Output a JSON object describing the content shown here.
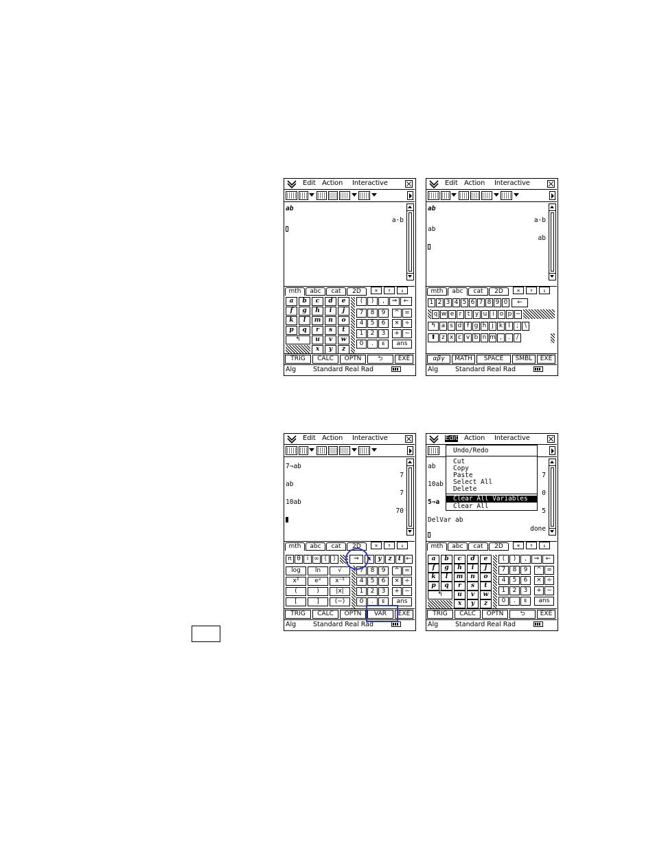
{
  "menu": {
    "edit": "Edit",
    "action": "Action",
    "interactive": "Interactive"
  },
  "tabs": {
    "mth": "mth",
    "abc": "abc",
    "cat": "cat",
    "d2": "2D"
  },
  "softkeys_mth": [
    "TRIG",
    "CALC",
    "OPTN",
    "⮌",
    "EXE"
  ],
  "softkeys_var": [
    "TRIG",
    "CALC",
    "OPTN",
    "VAR",
    "EXE"
  ],
  "softkeys_abc": [
    "αβγ",
    "MATH",
    "SPACE",
    "SMBL",
    "EXE"
  ],
  "status": {
    "mode": "Alg",
    "settings": "Standard Real Rad"
  },
  "screen1": {
    "lines": [
      {
        "text": "ab",
        "style": "b",
        "align": "l"
      },
      {
        "text": "a·b",
        "align": "r"
      }
    ]
  },
  "screen2": {
    "lines": [
      {
        "text": "ab",
        "style": "b",
        "align": "l"
      },
      {
        "text": "a·b",
        "align": "r"
      },
      {
        "text": "ab",
        "align": "l"
      },
      {
        "text": "ab",
        "align": "r"
      }
    ]
  },
  "screen3": {
    "lines": [
      {
        "text": "7⇒ab",
        "align": "l"
      },
      {
        "text": "7",
        "align": "r"
      },
      {
        "text": "ab",
        "align": "l"
      },
      {
        "text": "7",
        "align": "r"
      },
      {
        "text": "10ab",
        "align": "l"
      },
      {
        "text": "70",
        "align": "r"
      }
    ]
  },
  "screen4": {
    "lines": [
      {
        "text": "ab",
        "align": "l"
      },
      {
        "text": "7",
        "align": "r"
      },
      {
        "text": "10ab",
        "align": "l"
      },
      {
        "text": "0",
        "align": "r"
      },
      {
        "text": "5⇒a",
        "align": "l"
      },
      {
        "text": "5",
        "align": "r"
      },
      {
        "text": "DelVar ab",
        "align": "l"
      },
      {
        "text": "done",
        "align": "r"
      }
    ],
    "dropdown": [
      "Undo/Redo",
      "Cut",
      "Copy",
      "Paste",
      "Select All",
      "Delete",
      "Clear All Variables",
      "Clear All"
    ]
  },
  "keypad_letters": [
    "a",
    "b",
    "c",
    "d",
    "e",
    "f",
    "g",
    "h",
    "i",
    "j",
    "k",
    "l",
    "m",
    "n",
    "o",
    "p",
    "q",
    "r",
    "s",
    "t",
    "u",
    "v",
    "w",
    "x",
    "y",
    "z"
  ],
  "keypad_numeric": [
    "(",
    ")",
    ",",
    "⇒",
    "←",
    "7",
    "8",
    "9",
    "^",
    "=",
    "4",
    "5",
    "6",
    "×",
    "÷",
    "1",
    "2",
    "3",
    "+",
    "−",
    "0",
    ".",
    "E",
    "ans"
  ],
  "keypad_symbols": [
    "π",
    "θ",
    "i",
    "∞",
    "⟨",
    "⟩",
    "⇒",
    "x",
    "y",
    "z",
    "t",
    "←",
    "log",
    "ln",
    "√",
    "x²",
    "eˣ",
    "x⁻¹",
    "(",
    ")",
    "|x|",
    "[",
    "]",
    "(−)"
  ],
  "qwerty": {
    "row1": [
      "1",
      "2",
      "3",
      "4",
      "5",
      "6",
      "7",
      "8",
      "9",
      "0",
      "←"
    ],
    "row2": [
      "q",
      "w",
      "e",
      "r",
      "t",
      "y",
      "u",
      "i",
      "o",
      "p",
      "−"
    ],
    "row3": [
      "a",
      "s",
      "d",
      "f",
      "g",
      "h",
      "j",
      "k",
      "l",
      ";",
      "\\"
    ],
    "row4": [
      "⬆",
      "z",
      "x",
      "c",
      "v",
      "b",
      "n",
      "m",
      ",",
      ".",
      "/"
    ]
  },
  "annotation_colour": "#2f36c8"
}
